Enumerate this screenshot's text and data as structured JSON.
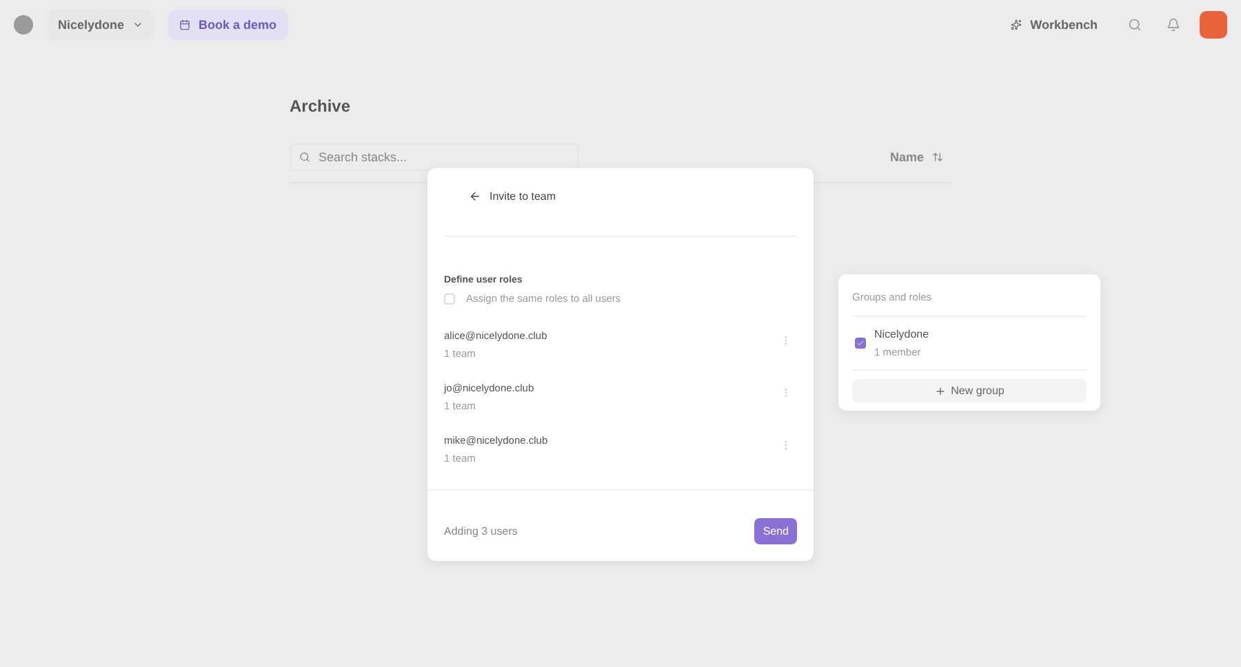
{
  "topbar": {
    "workspace": "Nicelydone",
    "demo_button": "Book a demo",
    "workbench": "Workbench"
  },
  "page": {
    "title": "Archive",
    "search": {
      "placeholder": "Search stacks..."
    },
    "sort": "Name"
  },
  "dialog": {
    "title": "Invite to team",
    "roles_heading": "Define user roles",
    "same_roles": {
      "label": "Assign the same roles to all users",
      "checked": false
    },
    "users": [
      {
        "email": "alice@nicelydone.club",
        "teams": "1 team"
      },
      {
        "email": "jo@nicelydone.club",
        "teams": "1 team"
      },
      {
        "email": "mike@nicelydone.club",
        "teams": "1 team"
      }
    ],
    "footer": "Adding 3 users",
    "send": "Send"
  },
  "groups_popover": {
    "heading": "Groups and roles",
    "groups": [
      {
        "name": "Nicelydone",
        "members": "1 member",
        "checked": true
      }
    ],
    "new_group": "New group"
  }
}
